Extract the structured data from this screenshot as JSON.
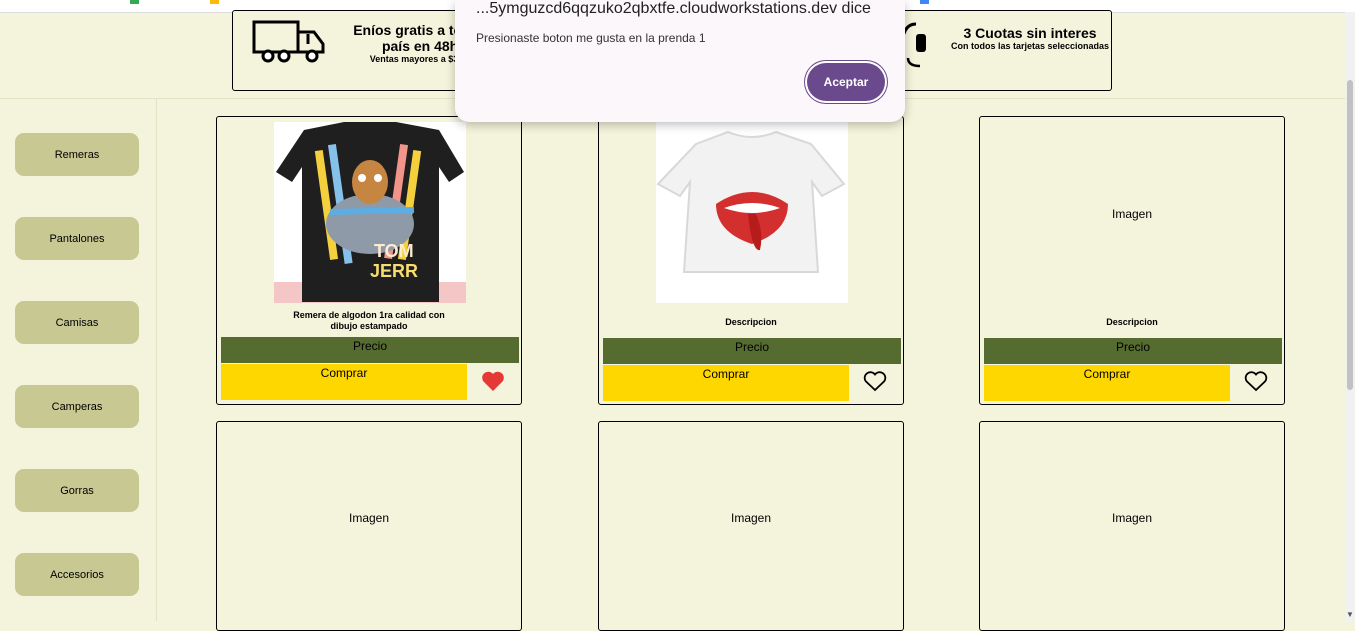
{
  "banner": {
    "shipping_title": "Eníos gratis a todo el país en 48hs",
    "shipping_sub": "Ventas mayores a $30000",
    "installments_title": "3 Cuotas sin interes",
    "installments_sub": "Con todos las tarjetas seleccionadas"
  },
  "sidebar": {
    "items": [
      {
        "label": "Remeras"
      },
      {
        "label": "Pantalones"
      },
      {
        "label": "Camisas"
      },
      {
        "label": "Camperas"
      },
      {
        "label": "Gorras"
      },
      {
        "label": "Accesorios"
      }
    ]
  },
  "products": [
    {
      "description": "Remera de algodon 1ra calidad con dibujo estampado",
      "price_label": "Precio",
      "buy_label": "Comprar",
      "liked": true,
      "image": "tom-and-jerry-tshirt"
    },
    {
      "description": "Descripcion",
      "price_label": "Precio",
      "buy_label": "Comprar",
      "liked": false,
      "image": "rolling-stones-tshirt"
    },
    {
      "image_placeholder": "Imagen",
      "description": "Descripcion",
      "price_label": "Precio",
      "buy_label": "Comprar",
      "liked": false
    },
    {
      "image_placeholder": "Imagen"
    },
    {
      "image_placeholder": "Imagen"
    },
    {
      "image_placeholder": "Imagen"
    }
  ],
  "dialog": {
    "title": "...5ymguzcd6qqzuko2qbxtfe.cloudworkstations.dev dice",
    "message": "Presionaste boton me gusta en la prenda 1",
    "accept_label": "Aceptar"
  },
  "colors": {
    "background": "#f4f4dc",
    "sidebar_button": "#c8c893",
    "price_bar": "#556b2f",
    "buy_button": "#ffd700",
    "dialog_button": "#6a4a8c",
    "heart_liked": "#e53935"
  },
  "icons": [
    "truck-icon",
    "headset-icon",
    "heart-icon"
  ]
}
